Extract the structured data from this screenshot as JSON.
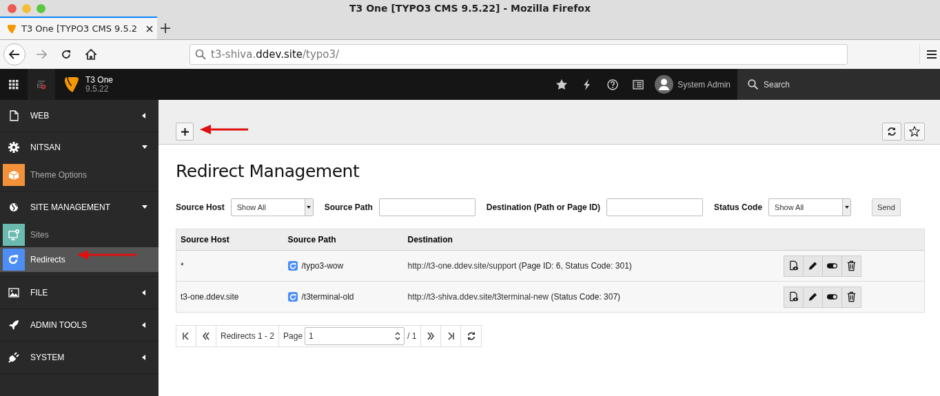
{
  "browser": {
    "window_title": "T3 One [TYPO3 CMS 9.5.22] - Mozilla Firefox",
    "tab": {
      "label": "T3 One [TYPO3 CMS 9.5.2",
      "selected": true
    },
    "url": {
      "subdomain": "t3-shiva.",
      "domain": "ddev.site",
      "path": "/typo3/"
    }
  },
  "topbar": {
    "site_name": "T3 One",
    "version": "9.5.22",
    "user": "System Admin",
    "search": "Search"
  },
  "sidebar": {
    "groups": [
      {
        "label": "WEB",
        "expanded": false
      },
      {
        "label": "NITSAN",
        "expanded": true,
        "modules": [
          {
            "label": "Theme Options",
            "color": "#f2913a",
            "selected": false
          }
        ]
      },
      {
        "label": "SITE MANAGEMENT",
        "expanded": true,
        "modules": [
          {
            "label": "Sites",
            "color": "#6abab0",
            "selected": false
          },
          {
            "label": "Redirects",
            "color": "#4c8ef6",
            "selected": true
          }
        ]
      },
      {
        "label": "FILE",
        "expanded": false
      },
      {
        "label": "ADMIN TOOLS",
        "expanded": false
      },
      {
        "label": "SYSTEM",
        "expanded": false
      }
    ]
  },
  "content": {
    "title": "Redirect Management",
    "filters": [
      {
        "label": "Source Host",
        "kind": "select",
        "value": "Show All"
      },
      {
        "label": "Source Path",
        "kind": "text"
      },
      {
        "label": "Destination (Path or Page ID)",
        "kind": "text"
      },
      {
        "label": "Status Code",
        "kind": "select",
        "value": "Show All"
      }
    ],
    "send": "Send",
    "table": {
      "columns": [
        "Source Host",
        "Source Path",
        "Destination"
      ],
      "rows": [
        {
          "source_host": "*",
          "source_path": "/typo3-wow",
          "destination_url": "http://t3-one.ddev.site/support",
          "destination_note": " (Page ID: 6, Status Code: 301)"
        },
        {
          "source_host": "t3-one.ddev.site",
          "source_path": "/t3terminal-old",
          "destination_url": "http://t3-shiva.ddev.site/t3terminal-new",
          "destination_note": " (Status Code: 307)"
        }
      ]
    },
    "pagination": {
      "range": "Redirects 1 - 2",
      "page_label": "Page",
      "page": "1",
      "total": "/ 1"
    }
  }
}
